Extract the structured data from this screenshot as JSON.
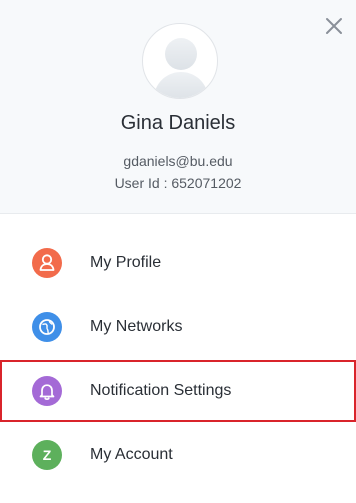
{
  "user": {
    "name": "Gina Daniels",
    "email": "gdaniels@bu.edu",
    "user_id_text": "User Id : 652071202"
  },
  "icons": {
    "close": "close-icon",
    "avatar": "user-silhouette-icon"
  },
  "menu": {
    "items": [
      {
        "label": "My Profile",
        "icon": "user-icon",
        "color": "#f26b4b"
      },
      {
        "label": "My Networks",
        "icon": "globe-icon",
        "color": "#3f8fe8"
      },
      {
        "label": "Notification Settings",
        "icon": "bell-icon",
        "color": "#a46ad6",
        "highlighted": true
      },
      {
        "label": "My Account",
        "icon": "account-letter-icon",
        "letter": "Z",
        "color": "#5db05c"
      }
    ]
  },
  "colors": {
    "highlight_border": "#d9242b",
    "header_bg": "#f7f9fb"
  }
}
